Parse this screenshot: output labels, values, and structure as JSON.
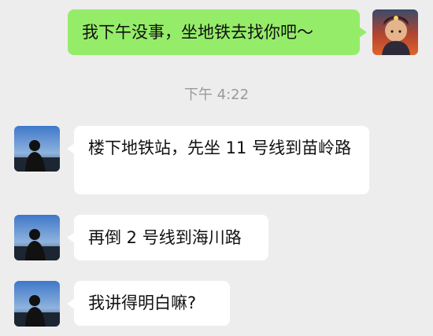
{
  "chat": {
    "outgoing": {
      "text": "我下午没事，坐地铁去找你吧～",
      "avatar_icon": "user-avatar-red-scene"
    },
    "timestamp": "下午 4:22",
    "incoming": [
      {
        "text": "楼下地铁站，先坐 11 号线到苗岭路",
        "avatar_icon": "contact-avatar-silhouette"
      },
      {
        "text": "再倒 2 号线到海川路",
        "avatar_icon": "contact-avatar-silhouette"
      },
      {
        "text": "我讲得明白嘛?",
        "avatar_icon": "contact-avatar-silhouette"
      }
    ]
  },
  "colors": {
    "background": "#ededed",
    "outgoing_bubble": "#95ec69",
    "incoming_bubble": "#ffffff",
    "timestamp_text": "#9a9a9a"
  }
}
